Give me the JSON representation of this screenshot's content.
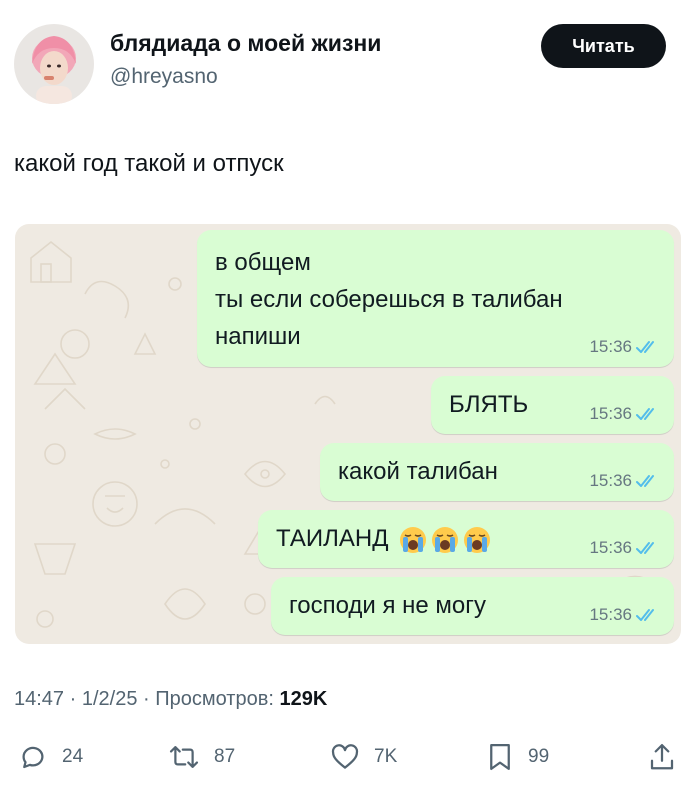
{
  "author": {
    "display_name": "блядиада о моей жизни",
    "handle": "@hreyasno",
    "follow_label": "Читать"
  },
  "tweet": {
    "text": "какой год такой и отпуск",
    "time": "14:47",
    "date": "1/2/25",
    "views_label": "Просмотров:",
    "views": "129K"
  },
  "chat": {
    "messages": [
      {
        "lines": [
          "в общем",
          "ты если соберешься в талибан",
          "напиши"
        ],
        "time": "15:36"
      },
      {
        "text": "БЛЯТЬ",
        "time": "15:36"
      },
      {
        "text": "какой талибан",
        "time": "15:36"
      },
      {
        "text": "ТАИЛАНД",
        "emoji": "loudly-crying-face ×3",
        "time": "15:36"
      },
      {
        "text": "господи я не могу",
        "time": "15:36"
      }
    ],
    "colors": {
      "bubble": "#d9fdd3",
      "wallpaper": "#efeae2",
      "read_ticks": "#53bdeb"
    }
  },
  "actions": {
    "replies": "24",
    "reposts": "87",
    "likes": "7K",
    "bookmarks": "99",
    "icons": [
      "reply-icon",
      "repost-icon",
      "like-icon",
      "bookmark-icon",
      "share-icon"
    ]
  },
  "colors": {
    "text_primary": "#0f1419",
    "text_secondary": "#536471",
    "button_bg": "#0f1419"
  }
}
